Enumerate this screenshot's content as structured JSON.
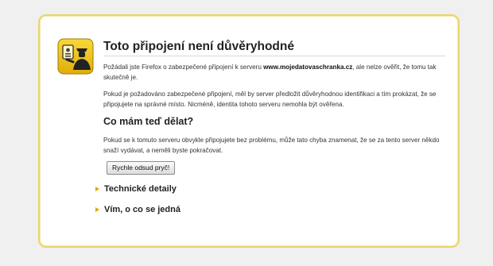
{
  "page": {
    "title": "Toto připojení není důvěryhodné",
    "intro_prefix": "Požádali jste Firefox o zabezpečené připojení k serveru ",
    "server": "www.mojedatovaschranka.cz",
    "intro_suffix": ", ale nelze ověřit, že tomu tak skutečně je.",
    "paragraph2": "Pokud je požadováno zabezpečené připojení, měl by server předložit důvěryhodnou identifikaci a tím prokázat, že se připojujete na správné místo. Nicméně, identita tohoto serveru nemohla být ověřena.",
    "what_to_do_heading": "Co mám teď dělat?",
    "paragraph3": "Pokud se k tomuto serveru obvykle připojujete bez problému, může tato chyba znamenat, že se za tento server někdo snaží vydávat, a neměli byste pokračovat.",
    "get_out_button": "Rychle odsud pryč!",
    "expanders": [
      {
        "label": "Technické detaily"
      },
      {
        "label": "Vím, o co se jedná"
      }
    ]
  },
  "colors": {
    "card_border": "#e9d66b",
    "expander_arrow": "#e0a800",
    "icon_background": "#f1c40f"
  },
  "icons": {
    "warning": "policeman-id-check-icon"
  }
}
